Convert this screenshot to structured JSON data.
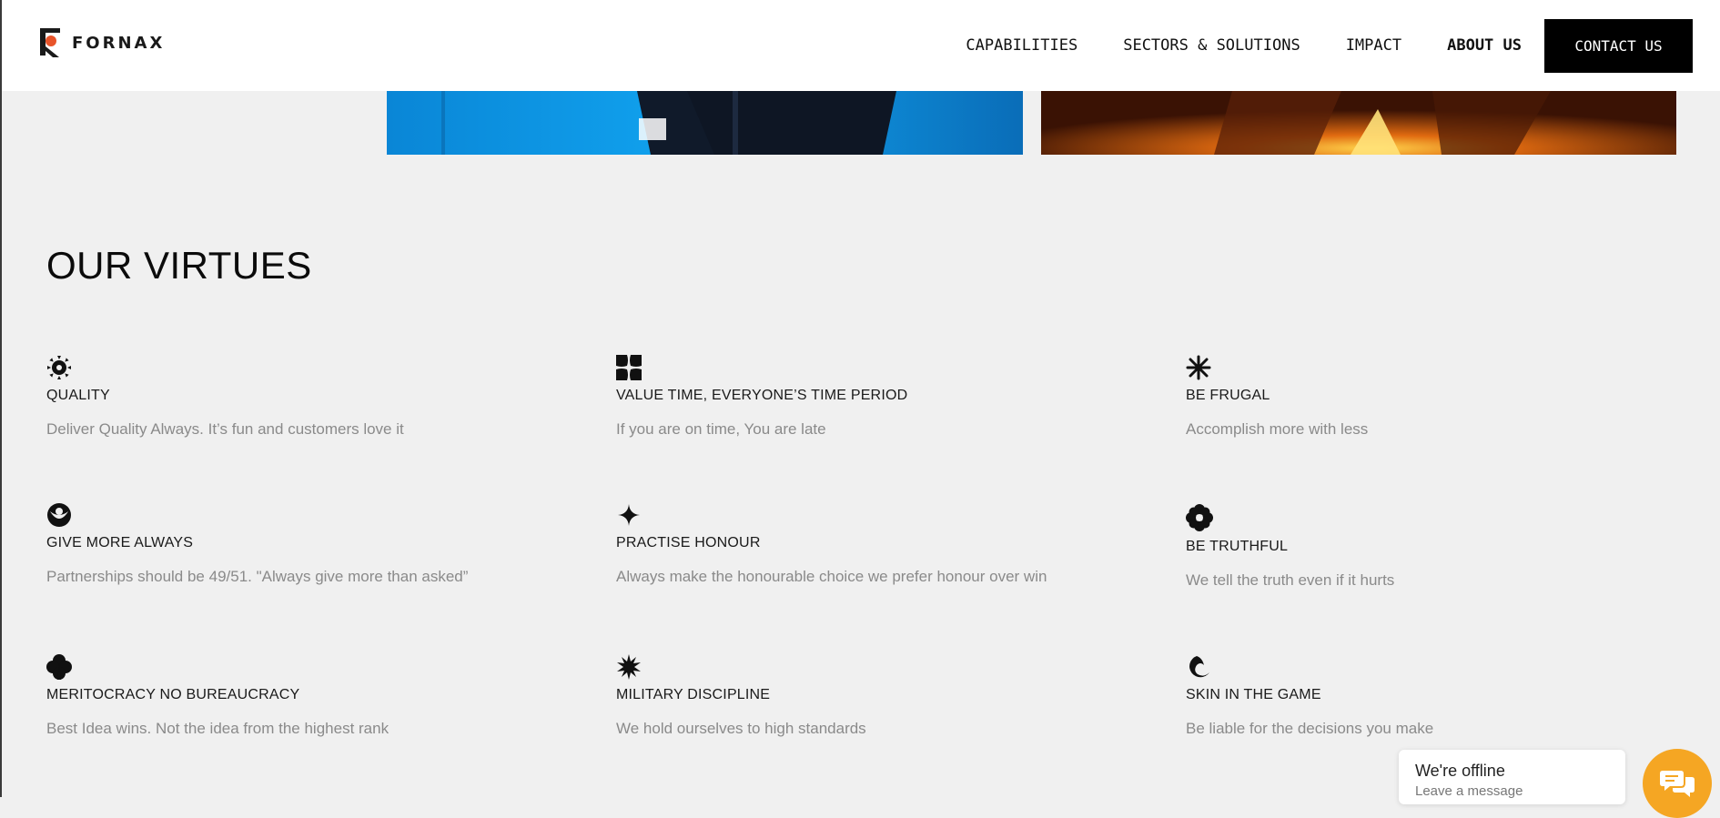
{
  "brand": {
    "name": "FORNAX",
    "accent": "#e8542a"
  },
  "nav": {
    "links": [
      {
        "label": "CAPABILITIES"
      },
      {
        "label": "SECTORS & SOLUTIONS"
      },
      {
        "label": "IMPACT"
      },
      {
        "label": "ABOUT US"
      }
    ],
    "contact_label": "CONTACT US"
  },
  "section": {
    "title": "OUR VIRTUES"
  },
  "virtues": [
    {
      "icon": "sunburst-icon",
      "title": "QUALITY",
      "desc": "Deliver Quality Always. It’s fun and customers love it"
    },
    {
      "icon": "quad-petal-icon",
      "title": "VALUE TIME, EVERYONE’S TIME PERIOD",
      "desc": "If you are on time, You are late"
    },
    {
      "icon": "asterisk-icon",
      "title": "BE FRUGAL",
      "desc": "Accomplish more with less"
    },
    {
      "icon": "crescent-eye-icon",
      "title": "GIVE MORE ALWAYS",
      "desc": "Partnerships should be 49/51. \"Always give more than asked”"
    },
    {
      "icon": "sparkle-icon",
      "title": "PRACTISE HONOUR",
      "desc": "Always make the honourable choice we prefer honour over win"
    },
    {
      "icon": "flower-icon",
      "title": "BE TRUTHFUL",
      "desc": "We tell the truth even if it hurts"
    },
    {
      "icon": "clover-icon",
      "title": "MERITOCRACY NO BUREAUCRACY",
      "desc": "Best Idea wins. Not the idea from the highest rank"
    },
    {
      "icon": "starburst-icon",
      "title": "MILITARY DISCIPLINE",
      "desc": "We hold ourselves to high standards"
    },
    {
      "icon": "wave-icon",
      "title": "SKIN IN THE GAME",
      "desc": "Be liable for the decisions you make"
    }
  ],
  "chat": {
    "status": "We're offline",
    "sub": "Leave a message",
    "button_color": "#f5a623",
    "icon": "chat-icon"
  }
}
